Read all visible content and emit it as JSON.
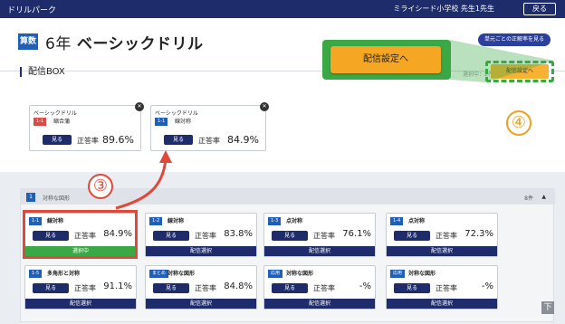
{
  "topbar": {
    "app_name": "ドリルパーク",
    "school_user": "ミライシード小学校 先生1先生",
    "back_label": "戻る"
  },
  "header": {
    "subject": "算数",
    "grade": "6年",
    "title": "ベーシックドリル",
    "unit_link": "単元ごとの正解率を見る"
  },
  "delivery": {
    "box_label": "配信BOX",
    "count": "選択中：2件",
    "settings_button": "配信設定へ",
    "callout_button": "配信設定へ"
  },
  "delivered_cards": [
    {
      "type": "ベーシックドリル",
      "code": "1-1",
      "name": "縮合蒲",
      "view": "見る",
      "rate_label": "正答率",
      "rate": "89.6%",
      "color": "#d94a4a"
    },
    {
      "type": "ベーシックドリル",
      "code": "1-1",
      "name": "線対称",
      "view": "見る",
      "rate_label": "正答率",
      "rate": "84.9%",
      "color": "#1f5fb8"
    }
  ],
  "drill": {
    "number": "1",
    "name": "対称な図形",
    "count": "8件",
    "units": [
      {
        "code": "1-1",
        "name": "線対称",
        "view": "見る",
        "rate_label": "正答率",
        "rate": "84.9%",
        "footer": "選択中",
        "selected": true
      },
      {
        "code": "1-2",
        "name": "線対称",
        "view": "見る",
        "rate_label": "正答率",
        "rate": "83.8%",
        "footer": "配信選択",
        "selected": false
      },
      {
        "code": "1-3",
        "name": "点対称",
        "view": "見る",
        "rate_label": "正答率",
        "rate": "76.1%",
        "footer": "配信選択",
        "selected": false
      },
      {
        "code": "1-4",
        "name": "点対称",
        "view": "見る",
        "rate_label": "正答率",
        "rate": "72.3%",
        "footer": "配信選択",
        "selected": false
      },
      {
        "code": "1-5",
        "name": "多角形と対称",
        "view": "見る",
        "rate_label": "正答率",
        "rate": "91.1%",
        "footer": "配信選択",
        "selected": false
      },
      {
        "code": "まとめ",
        "name": "対称な図形",
        "view": "見る",
        "rate_label": "正答率",
        "rate": "84.8%",
        "footer": "配信選択",
        "selected": false
      },
      {
        "code": "応用",
        "name": "対称な図形",
        "view": "見る",
        "rate_label": "正答率",
        "rate": "-%",
        "footer": "配信選択",
        "selected": false
      },
      {
        "code": "応用",
        "name": "対称な図形",
        "view": "見る",
        "rate_label": "正答率",
        "rate": "-%",
        "footer": "配信選択",
        "selected": false
      }
    ]
  },
  "annotations": {
    "step3": "③",
    "step4": "④",
    "red": "#e0483a",
    "orange": "#f0a020",
    "green": "#3aa845"
  },
  "scroll_top": "下"
}
